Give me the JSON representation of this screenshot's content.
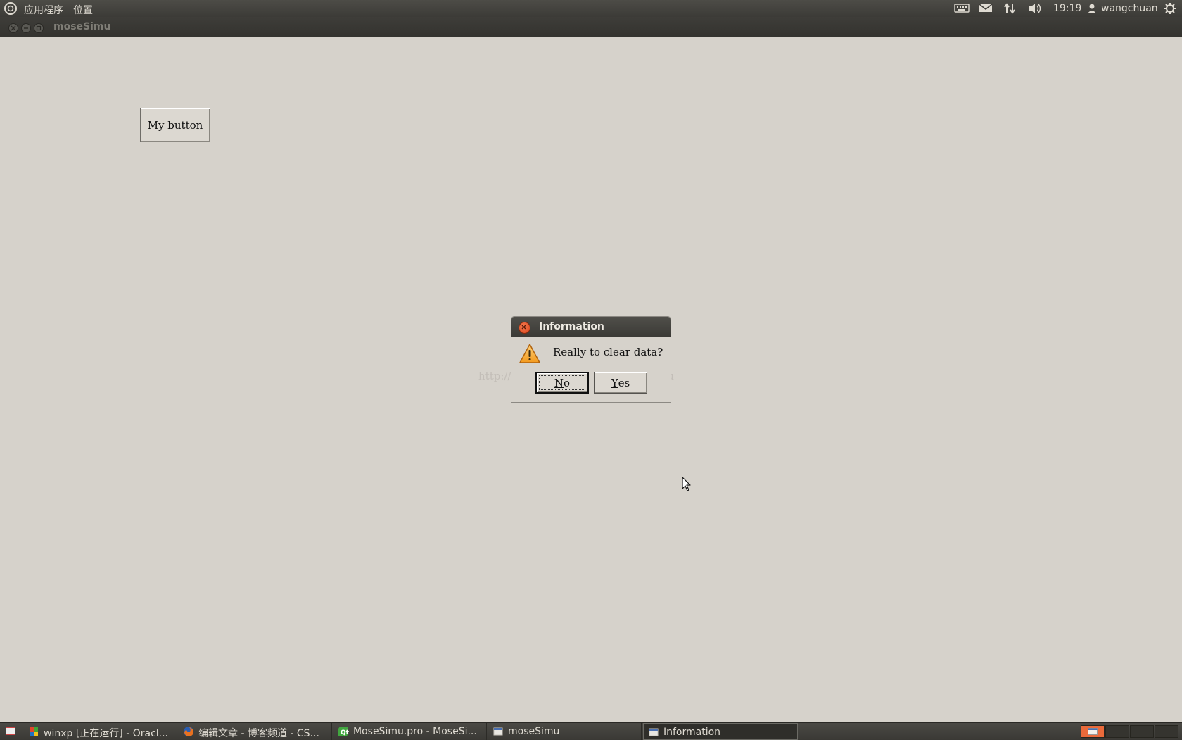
{
  "top_panel": {
    "menu_applications": "应用程序",
    "menu_places": "位置",
    "clock": "19:19",
    "user": "wangchuan",
    "icons": [
      "ubuntu-logo-icon",
      "keyboard-icon",
      "mail-icon",
      "network-icon",
      "volume-icon",
      "user-icon",
      "power-icon"
    ]
  },
  "window": {
    "title": "moseSimu"
  },
  "content": {
    "my_button_label": "My button"
  },
  "dialog": {
    "title": "Information",
    "message": "Really to clear data?",
    "no_mnemonic": "N",
    "no_rest": "o",
    "yes_mnemonic": "Y",
    "yes_rest": "es",
    "icon": "warning-icon"
  },
  "watermark": "http://blog.csdn.net/wangchuansnnu",
  "taskbar": {
    "tasks": [
      {
        "label": "winxp [正在运行] - Oracl...",
        "icon": "virtualbox-icon"
      },
      {
        "label": "编辑文章 - 博客频道 - CS...",
        "icon": "firefox-icon"
      },
      {
        "label": "MoseSimu.pro - MoseSi...",
        "icon": "qtcreator-icon"
      },
      {
        "label": "moseSimu",
        "icon": "window-icon"
      },
      {
        "label": "Information",
        "icon": "window-icon",
        "active": true
      }
    ],
    "workspaces": 4,
    "active_workspace": 1
  },
  "colors": {
    "background": "#d6d2cb",
    "panel": "#3c3b37",
    "accent": "#e96a3b"
  }
}
